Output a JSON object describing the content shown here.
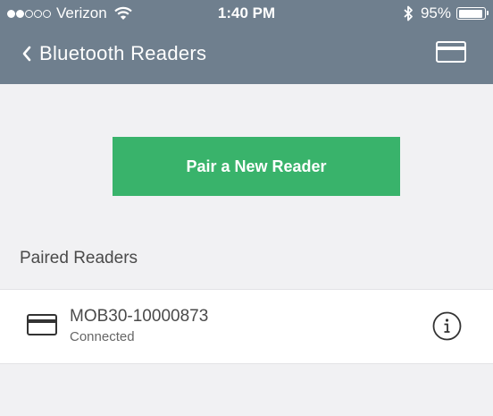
{
  "status_bar": {
    "carrier": "Verizon",
    "time": "1:40 PM",
    "battery_percent": "95%",
    "battery_level": 0.95,
    "signal_bars": 2
  },
  "nav": {
    "title": "Bluetooth Readers",
    "back_icon": "chevron-left-icon",
    "right_icon": "card-icon"
  },
  "pair_button": {
    "label": "Pair a New Reader",
    "color": "#39b36b"
  },
  "paired_section": {
    "header": "Paired Readers",
    "readers": [
      {
        "name": "MOB30-10000873",
        "status": "Connected",
        "icon": "card-icon",
        "action_icon": "info-icon"
      }
    ]
  },
  "colors": {
    "nav": "#6f7f8e",
    "background": "#f1f1f3",
    "accent": "#39b36b"
  }
}
